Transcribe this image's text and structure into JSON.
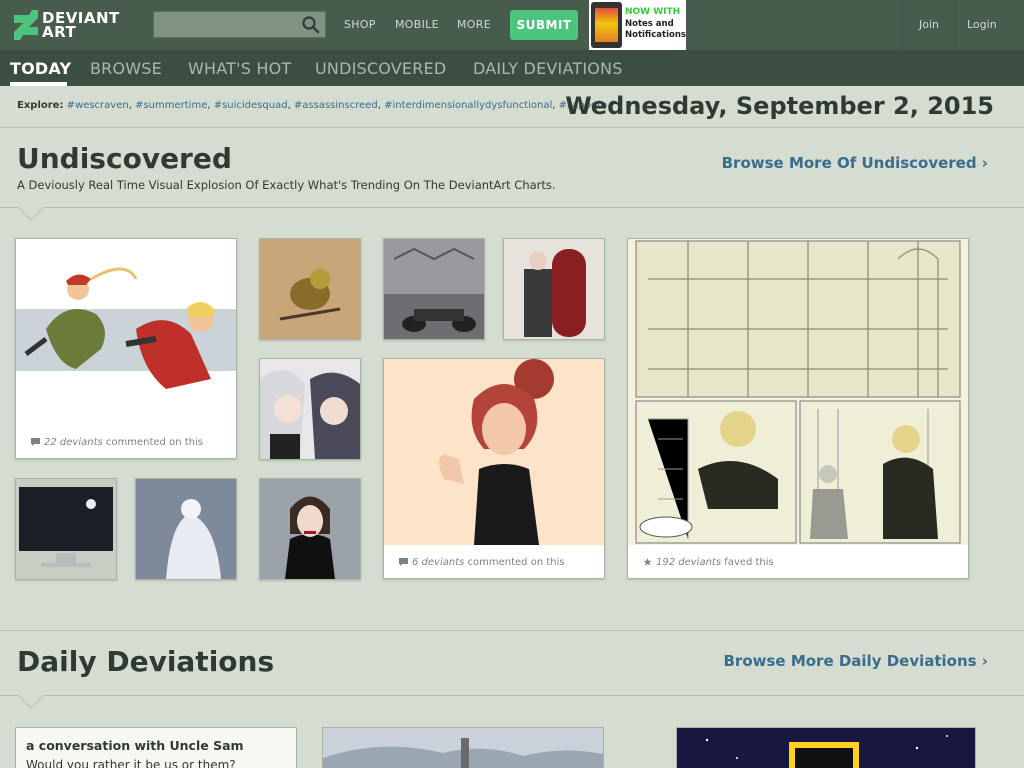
{
  "brand": {
    "logo_line1": "DEVIANT",
    "logo_line2": "ART",
    "logo_color": "#4dc47d"
  },
  "search": {
    "placeholder": "",
    "value": ""
  },
  "topnav": {
    "shop": "SHOP",
    "mobile": "MOBILE",
    "more": "MORE",
    "submit": "SUBMIT",
    "join": "Join",
    "login": "Login"
  },
  "promo": {
    "title": "NOW WITH",
    "line1": "Notes and",
    "line2": "Notifications"
  },
  "tabs": [
    {
      "label": "TODAY",
      "active": true
    },
    {
      "label": "BROWSE",
      "active": false
    },
    {
      "label": "WHAT'S HOT",
      "active": false
    },
    {
      "label": "UNDISCOVERED",
      "active": false
    },
    {
      "label": "DAILY DEVIATIONS",
      "active": false
    }
  ],
  "explore": {
    "label": "Explore:",
    "tags": [
      "#wescraven",
      "#summertime",
      "#suicidesquad",
      "#assassinscreed",
      "#interdimensionallydysfunctional",
      "#sapporo"
    ]
  },
  "date": "Wednesday, September 2, 2015",
  "undiscovered": {
    "title": "Undiscovered",
    "subtitle": "A Deviously Real Time Visual Explosion Of Exactly What's Trending On The DeviantArt Charts.",
    "link": "Browse More Of Undiscovered ›",
    "cards": [
      {
        "count": "22 deviants",
        "suffix": " commented on this",
        "icon": "comment-icon"
      },
      {
        "count": "6 deviants",
        "suffix": " commented on this",
        "icon": "comment-icon"
      },
      {
        "count": "192 deviants",
        "suffix": " faved this",
        "icon": "star-icon"
      }
    ]
  },
  "daily": {
    "title": "Daily Deviations",
    "link": "Browse More Daily Deviations ›",
    "card_title": "a conversation with Uncle Sam",
    "card_text": "Would you rather it be us or them?"
  },
  "colors": {
    "topbar": "#475c4d",
    "tabbar": "#3c4e42",
    "page_bg": "#d4ddd0",
    "accent_green": "#4dc47d",
    "link_blue": "#3a6c8e"
  }
}
